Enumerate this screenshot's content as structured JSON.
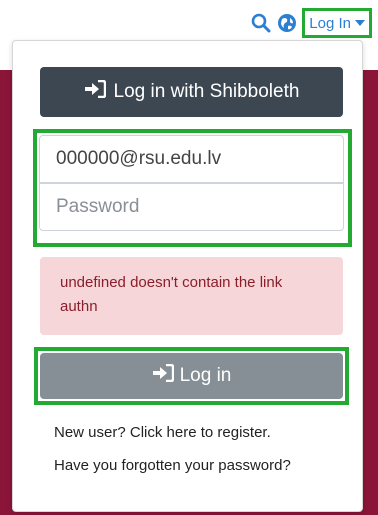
{
  "nav": {
    "icons": [
      "search-icon",
      "globe-icon"
    ],
    "login_toggle_label": "Log In"
  },
  "login_dropdown": {
    "shibboleth_button_label": "Log in with Shibboleth",
    "email_value": "000000@rsu.edu.lv",
    "password_placeholder": "Password",
    "error_message": "undefined doesn't contain the link authn",
    "login_button_label": "Log in",
    "register_link": "New user? Click here to register.",
    "forgot_password_link": "Have you forgotten your password?"
  },
  "colors": {
    "brand_maroon": "#8a1538",
    "link_blue": "#2a7fd4",
    "highlight_green": "#22aa33",
    "shibboleth_button": "#3d4752",
    "login_button": "#868e96",
    "alert_bg": "#f6d6d8",
    "alert_text": "#8a1f2b"
  }
}
